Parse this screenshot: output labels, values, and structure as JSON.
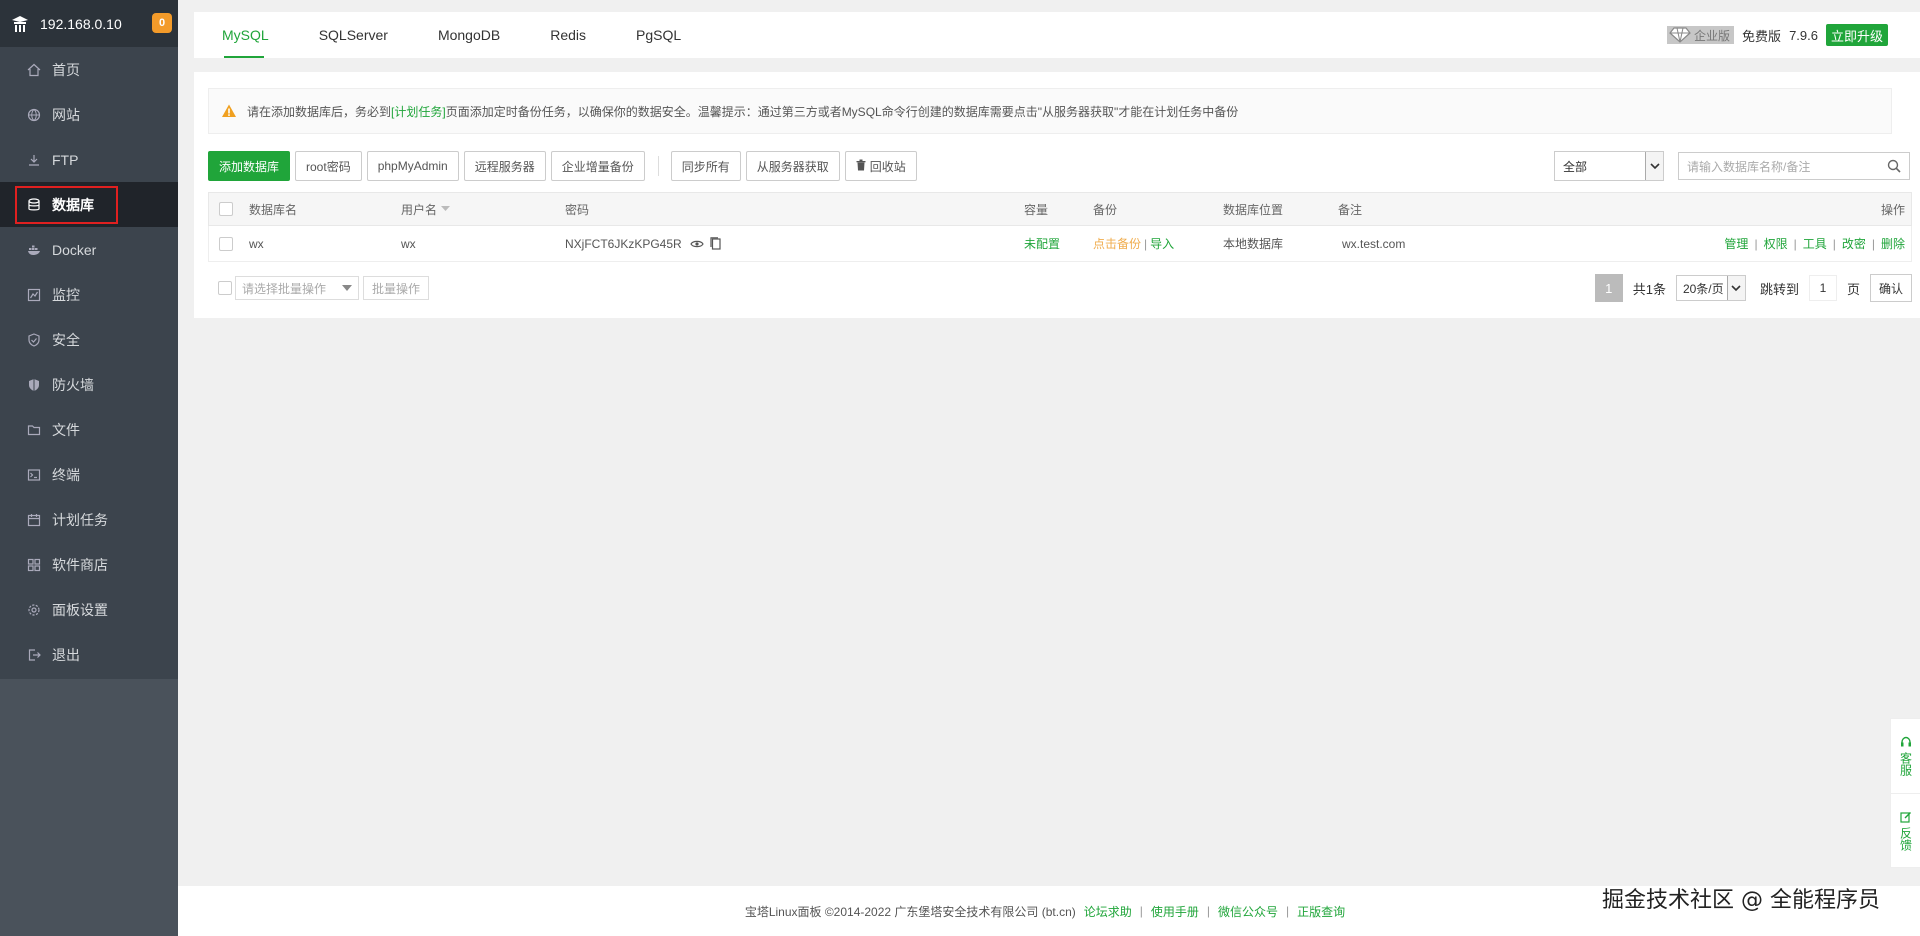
{
  "sidebar": {
    "host": "192.168.0.10",
    "badge": "0",
    "items": [
      {
        "label": "首页",
        "icon": "home-icon"
      },
      {
        "label": "网站",
        "icon": "globe-icon"
      },
      {
        "label": "FTP",
        "icon": "ftp-icon"
      },
      {
        "label": "数据库",
        "icon": "database-icon"
      },
      {
        "label": "Docker",
        "icon": "docker-icon"
      },
      {
        "label": "监控",
        "icon": "monitor-icon"
      },
      {
        "label": "安全",
        "icon": "shield-icon"
      },
      {
        "label": "防火墙",
        "icon": "firewall-icon"
      },
      {
        "label": "文件",
        "icon": "folder-icon"
      },
      {
        "label": "终端",
        "icon": "terminal-icon"
      },
      {
        "label": "计划任务",
        "icon": "calendar-icon"
      },
      {
        "label": "软件商店",
        "icon": "apps-icon"
      },
      {
        "label": "面板设置",
        "icon": "gear-icon"
      },
      {
        "label": "退出",
        "icon": "logout-icon"
      }
    ]
  },
  "tabs": [
    "MySQL",
    "SQLServer",
    "MongoDB",
    "Redis",
    "PgSQL"
  ],
  "version": {
    "enterprise": "企业版",
    "free": "免费版",
    "number": "7.9.6",
    "upgrade": "立即升级"
  },
  "notice": {
    "before": "请在添加数据库后，务必到",
    "link": "[计划任务]",
    "after": "页面添加定时备份任务，以确保你的数据安全。温馨提示：通过第三方或者MySQL命令行创建的数据库需要点击\"从服务器获取\"才能在计划任务中备份"
  },
  "toolbar": {
    "add": "添加数据库",
    "root": "root密码",
    "phpmyadmin": "phpMyAdmin",
    "remote": "远程服务器",
    "incremental": "企业增量备份",
    "sync": "同步所有",
    "fetch": "从服务器获取",
    "recycle": "回收站",
    "filter": "全部",
    "search_placeholder": "请输入数据库名称/备注"
  },
  "table": {
    "headers": {
      "name": "数据库名",
      "user": "用户名",
      "password": "密码",
      "capacity": "容量",
      "backup": "备份",
      "location": "数据库位置",
      "remark": "备注",
      "ops": "操作"
    },
    "rows": [
      {
        "name": "wx",
        "user": "wx",
        "password": "NXjFCT6JKzKPG45R",
        "capacity": "未配置",
        "backup_click": "点击备份",
        "backup_import": "导入",
        "location": "本地数据库",
        "remark": "wx.test.com",
        "ops": [
          "管理",
          "权限",
          "工具",
          "改密",
          "删除"
        ]
      }
    ]
  },
  "batch": {
    "select": "请选择批量操作",
    "button": "批量操作"
  },
  "pager": {
    "current": "1",
    "total": "共1条",
    "per_page": "20条/页",
    "jump_label": "跳转到",
    "jump_value": "1",
    "page_unit": "页",
    "confirm": "确认"
  },
  "footer": {
    "copyright": "宝塔Linux面板 ©2014-2022 广东堡塔安全技术有限公司 (bt.cn)",
    "links": [
      "论坛求助",
      "使用手册",
      "微信公众号",
      "正版查询"
    ]
  },
  "float": {
    "service": "客服",
    "feedback": "反馈"
  },
  "watermark": {
    "text": "掘金技术社区 @ 全能程序员"
  },
  "colors": {
    "brand": "#20a53a",
    "sidebar": "#3c444d",
    "highlight": "#e02020"
  }
}
